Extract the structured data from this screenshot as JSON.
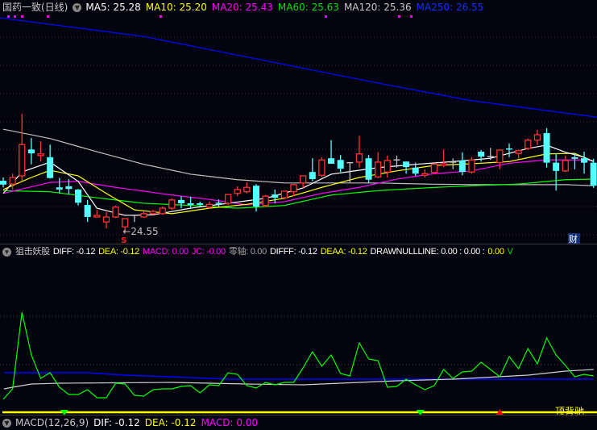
{
  "header": {
    "stock": "国药一致(日线)",
    "ma5": "MA5: 25.28",
    "ma10": "MA10: 25.20",
    "ma20": "MA20: 25.43",
    "ma60": "MA60: 25.63",
    "ma120": "MA120: 25.36",
    "ma250": "MA250: 26.55"
  },
  "indicator_header": {
    "name": "狙击妖股",
    "diff": "DIFF: -0.12",
    "dea": "DEA: -0.12",
    "macd": "MACD: 0.00",
    "jc": "JC: -0.00",
    "zero": "零轴: 0.00",
    "difff": "DIFFF: -0.12",
    "deaa": "DEAA: -0.12",
    "drawnull": "DRAWNULLLINE: 0.00 : 0.00 :",
    "last": "0.00",
    "cut": "V"
  },
  "macd_header": {
    "name": "MACD(12,26,9)",
    "dif": "DIF: -0.12",
    "dea": "DEA: -0.12",
    "macd": "MACD: 0.00"
  },
  "annotations": {
    "low_label": "←24.55",
    "sell_mark": "S",
    "finance_mark": "财",
    "divergence_label": "顶背驰"
  },
  "colors": {
    "up": "#ff3232",
    "down": "#54ffff",
    "flat": "#c0c0c0",
    "ma5": "#ffffff",
    "ma10": "#ffff00",
    "ma20": "#ff00ff",
    "ma60": "#00ff00",
    "ma120": "#c0c0c0",
    "ma250": "#0000ff"
  },
  "chart_data": {
    "type": "candlestick",
    "price_range": [
      24.2,
      28.5
    ],
    "candles": [
      [
        25.49,
        25.42,
        25.55,
        25.37
      ],
      [
        25.43,
        25.55,
        25.62,
        25.33
      ],
      [
        25.58,
        26.15,
        26.71,
        25.48
      ],
      [
        26.06,
        25.99,
        26.27,
        25.79
      ],
      [
        25.95,
        25.98,
        26.21,
        25.84
      ],
      [
        25.92,
        25.54,
        26.15,
        25.53
      ],
      [
        25.37,
        25.33,
        25.54,
        25.26
      ],
      [
        25.39,
        25.34,
        25.52,
        25.24
      ],
      [
        25.33,
        25.09,
        25.34,
        25.04
      ],
      [
        25.05,
        24.83,
        25.14,
        24.74
      ],
      [
        24.83,
        24.86,
        24.96,
        24.82
      ],
      [
        24.74,
        24.83,
        24.92,
        24.62
      ],
      [
        24.83,
        25.01,
        25.04,
        24.81
      ],
      [
        24.65,
        24.8,
        24.8,
        24.55
      ],
      [
        24.86,
        24.86,
        24.87,
        24.74
      ],
      [
        24.83,
        24.89,
        24.93,
        24.82
      ],
      [
        24.89,
        24.93,
        24.96,
        24.87
      ],
      [
        24.89,
        24.99,
        25.02,
        24.87
      ],
      [
        24.99,
        25.14,
        25.17,
        24.96
      ],
      [
        25.14,
        25.08,
        25.21,
        24.99
      ],
      [
        25.08,
        25.05,
        25.2,
        24.99
      ],
      [
        25.08,
        25.05,
        25.11,
        25.02
      ],
      [
        25.01,
        25.06,
        25.11,
        24.98
      ],
      [
        25.09,
        25.08,
        25.15,
        25.01
      ],
      [
        25.08,
        25.24,
        25.24,
        25.05
      ],
      [
        25.26,
        25.33,
        25.39,
        25.21
      ],
      [
        25.29,
        25.37,
        25.46,
        25.26
      ],
      [
        25.4,
        25.02,
        25.43,
        24.93
      ],
      [
        25.04,
        25.21,
        25.23,
        25.01
      ],
      [
        25.24,
        25.18,
        25.33,
        25.08
      ],
      [
        25.18,
        25.3,
        25.31,
        25.15
      ],
      [
        25.29,
        25.42,
        25.43,
        25.21
      ],
      [
        25.45,
        25.58,
        25.58,
        25.36
      ],
      [
        25.65,
        25.52,
        25.9,
        25.48
      ],
      [
        25.59,
        25.87,
        25.92,
        25.56
      ],
      [
        25.9,
        25.8,
        26.23,
        25.8
      ],
      [
        25.87,
        25.71,
        25.96,
        25.65
      ],
      [
        25.82,
        25.82,
        25.83,
        25.46
      ],
      [
        25.83,
        25.98,
        26.31,
        25.73
      ],
      [
        25.9,
        25.51,
        25.96,
        25.45
      ],
      [
        25.56,
        25.83,
        26.01,
        25.54
      ],
      [
        25.65,
        25.86,
        25.95,
        25.55
      ],
      [
        25.87,
        25.87,
        25.95,
        25.73
      ],
      [
        25.84,
        25.74,
        25.84,
        25.62
      ],
      [
        25.73,
        25.62,
        25.82,
        25.58
      ],
      [
        25.59,
        25.62,
        25.7,
        25.55
      ],
      [
        25.64,
        25.79,
        25.8,
        25.64
      ],
      [
        25.77,
        25.8,
        26.06,
        25.74
      ],
      [
        25.83,
        25.83,
        25.9,
        25.7
      ],
      [
        25.86,
        25.65,
        26.01,
        25.59
      ],
      [
        25.65,
        25.87,
        25.92,
        25.62
      ],
      [
        26.02,
        25.93,
        26.05,
        25.84
      ],
      [
        25.93,
        25.93,
        26.09,
        25.87
      ],
      [
        25.82,
        26.05,
        26.05,
        25.7
      ],
      [
        26.08,
        26.06,
        26.17,
        25.92
      ],
      [
        25.99,
        26.04,
        26.06,
        25.89
      ],
      [
        26.08,
        26.23,
        26.26,
        26.05
      ],
      [
        26.23,
        26.33,
        26.42,
        26.14
      ],
      [
        26.36,
        25.82,
        26.45,
        25.73
      ],
      [
        25.82,
        25.67,
        25.99,
        25.31
      ],
      [
        25.67,
        25.86,
        25.95,
        25.65
      ],
      [
        25.92,
        25.89,
        25.99,
        25.7
      ],
      [
        25.9,
        25.82,
        26.02,
        25.62
      ],
      [
        25.82,
        25.4,
        25.89,
        25.36
      ]
    ],
    "ma_lines": {
      "ma5": [
        [
          0,
          25.26
        ],
        [
          2,
          25.65
        ],
        [
          5,
          25.83
        ],
        [
          8,
          25.48
        ],
        [
          10,
          24.99
        ],
        [
          13,
          24.86
        ],
        [
          16,
          24.87
        ],
        [
          20,
          24.99
        ],
        [
          24,
          25.08
        ],
        [
          28,
          25.17
        ],
        [
          32,
          25.36
        ],
        [
          35,
          25.61
        ],
        [
          40,
          25.73
        ],
        [
          44,
          25.79
        ],
        [
          48,
          25.84
        ],
        [
          52,
          25.9
        ],
        [
          56,
          26.08
        ],
        [
          58,
          26.14
        ],
        [
          60,
          26.01
        ],
        [
          62,
          25.92
        ],
        [
          63,
          25.84
        ]
      ],
      "ma10": [
        [
          0,
          25.33
        ],
        [
          3,
          25.55
        ],
        [
          5,
          25.68
        ],
        [
          8,
          25.58
        ],
        [
          11,
          25.26
        ],
        [
          14,
          24.96
        ],
        [
          18,
          24.89
        ],
        [
          22,
          24.99
        ],
        [
          26,
          25.06
        ],
        [
          30,
          25.17
        ],
        [
          34,
          25.37
        ],
        [
          38,
          25.55
        ],
        [
          42,
          25.67
        ],
        [
          46,
          25.77
        ],
        [
          50,
          25.8
        ],
        [
          54,
          25.84
        ],
        [
          58,
          25.98
        ],
        [
          61,
          25.99
        ],
        [
          63,
          25.84
        ]
      ],
      "ma20": [
        [
          0,
          25.26
        ],
        [
          5,
          25.46
        ],
        [
          8,
          25.48
        ],
        [
          12,
          25.37
        ],
        [
          18,
          25.23
        ],
        [
          22,
          25.15
        ],
        [
          26,
          25.05
        ],
        [
          30,
          25.11
        ],
        [
          34,
          25.26
        ],
        [
          38,
          25.37
        ],
        [
          42,
          25.52
        ],
        [
          46,
          25.62
        ],
        [
          50,
          25.67
        ],
        [
          54,
          25.81
        ],
        [
          58,
          25.87
        ],
        [
          62,
          25.87
        ],
        [
          63,
          25.86
        ]
      ],
      "ma60": [
        [
          0,
          25.31
        ],
        [
          5,
          25.29
        ],
        [
          10,
          25.18
        ],
        [
          15,
          25.08
        ],
        [
          20,
          25.04
        ],
        [
          25,
          24.99
        ],
        [
          30,
          25.04
        ],
        [
          35,
          25.23
        ],
        [
          40,
          25.31
        ],
        [
          45,
          25.36
        ],
        [
          50,
          25.4
        ],
        [
          55,
          25.43
        ],
        [
          60,
          25.51
        ],
        [
          63,
          25.52
        ]
      ],
      "ma120": [
        [
          0,
          26.43
        ],
        [
          5,
          26.26
        ],
        [
          10,
          26.02
        ],
        [
          15,
          25.79
        ],
        [
          20,
          25.61
        ],
        [
          25,
          25.51
        ],
        [
          30,
          25.45
        ],
        [
          40,
          25.45
        ],
        [
          45,
          25.43
        ],
        [
          50,
          25.42
        ],
        [
          60,
          25.42
        ],
        [
          63,
          25.4
        ]
      ],
      "ma250": [
        [
          0,
          28.46
        ],
        [
          15,
          28.12
        ],
        [
          30,
          27.61
        ],
        [
          40,
          27.27
        ],
        [
          50,
          26.95
        ],
        [
          63,
          26.65
        ]
      ]
    },
    "low_marker": {
      "index": 13,
      "price": 24.55
    },
    "indicator": {
      "green": [
        0.16,
        0.29,
        1.24,
        0.71,
        0.42,
        0.49,
        0.31,
        0.22,
        0.22,
        0.28,
        0.18,
        0.18,
        0.36,
        0.35,
        0.21,
        0.2,
        0.28,
        0.29,
        0.29,
        0.32,
        0.33,
        0.24,
        0.34,
        0.33,
        0.49,
        0.47,
        0.33,
        0.3,
        0.37,
        0.34,
        0.37,
        0.37,
        0.55,
        0.75,
        0.57,
        0.71,
        0.48,
        0.45,
        0.86,
        0.66,
        0.64,
        0.31,
        0.32,
        0.41,
        0.34,
        0.28,
        0.33,
        0.53,
        0.42,
        0.5,
        0.51,
        0.62,
        0.53,
        0.44,
        0.69,
        0.54,
        0.79,
        0.6,
        0.92,
        0.71,
        0.58,
        0.44,
        0.47,
        0.45
      ],
      "white": [
        [
          0,
          0.29
        ],
        [
          3,
          0.35
        ],
        [
          6,
          0.36
        ],
        [
          18,
          0.37
        ],
        [
          26,
          0.35
        ],
        [
          32,
          0.34
        ],
        [
          36,
          0.36
        ],
        [
          42,
          0.39
        ],
        [
          48,
          0.41
        ],
        [
          56,
          0.46
        ],
        [
          60,
          0.51
        ],
        [
          63,
          0.53
        ]
      ],
      "blue": [
        [
          0,
          0.49
        ],
        [
          9,
          0.49
        ],
        [
          13,
          0.46
        ],
        [
          20,
          0.43
        ],
        [
          24,
          0.41
        ],
        [
          63,
          0.41
        ]
      ],
      "sell_signals": [
        6,
        44
      ],
      "buy_signals": [
        53
      ]
    },
    "top_dots": [
      1,
      1,
      2,
      5,
      17,
      34,
      42,
      43
    ]
  }
}
